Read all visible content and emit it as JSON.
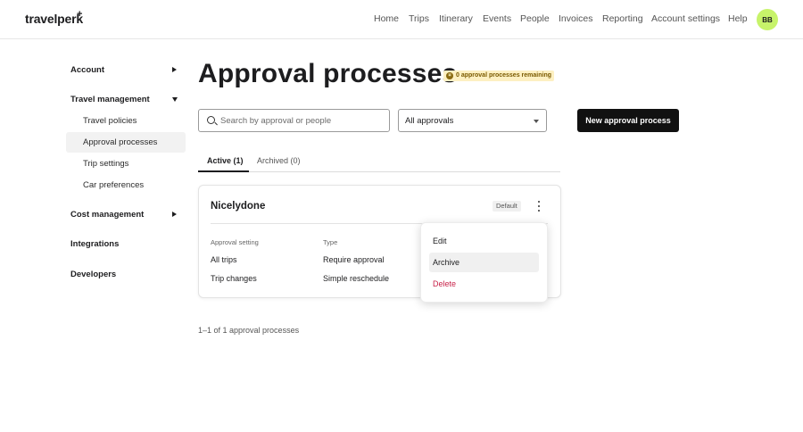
{
  "app": {
    "logo": "travelperk",
    "logo_mark": "+"
  },
  "nav": {
    "items": [
      "Home",
      "Trips",
      "Itinerary",
      "Events",
      "People",
      "Invoices",
      "Reporting",
      "Account settings",
      "Help"
    ],
    "avatar_initials": "BB"
  },
  "sidebar": {
    "account": "Account",
    "travel_management": "Travel management",
    "travel_sub": [
      "Travel policies",
      "Approval processes",
      "Trip settings",
      "Car preferences"
    ],
    "cost_management": "Cost management",
    "integrations": "Integrations",
    "developers": "Developers",
    "active_item": "Approval processes"
  },
  "main": {
    "title": "Approval processes",
    "remaining_badge": "0 approval processes remaining",
    "remaining_icon": "¤",
    "search_placeholder": "Search by approval or people",
    "filter_value": "All approvals",
    "new_button": "New approval process",
    "tabs": [
      "Active (1)",
      "Archived (0)"
    ],
    "pagination": "1–1 of 1 approval processes"
  },
  "card": {
    "title": "Nicelydone",
    "badge": "Default",
    "col_setting": "Approval setting",
    "col_type": "Type",
    "rows": [
      {
        "setting": "All trips",
        "type": "Require approval"
      },
      {
        "setting": "Trip changes",
        "type": "Simple reschedule"
      }
    ]
  },
  "menu": {
    "items": [
      "Edit",
      "Archive",
      "Delete"
    ],
    "hovered": "Archive"
  },
  "colors": {
    "avatar": "#c7f36a",
    "badge_bg": "#fdf0c2",
    "primary": "#111111",
    "danger": "#c8234a"
  }
}
